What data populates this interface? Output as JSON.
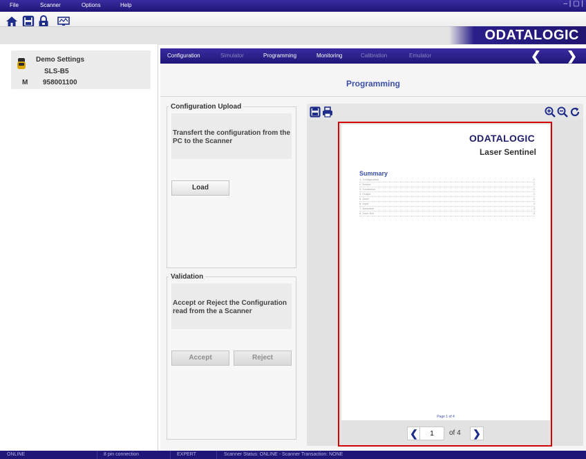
{
  "menu": {
    "file": "File",
    "scanner": "Scanner",
    "options": "Options",
    "help": "Help"
  },
  "window_controls": "– | ▢ |",
  "brand": {
    "logo": "ODATALOGIC"
  },
  "device": {
    "name": "Demo Settings",
    "model": "SLS-B5",
    "mode_letter": "M",
    "serial": "958001100"
  },
  "nav": {
    "tabs": [
      {
        "label": "Configuration",
        "active": true
      },
      {
        "label": "Simulator",
        "active": false
      },
      {
        "label": "Programming",
        "active": true
      },
      {
        "label": "Monitoring",
        "active": true
      },
      {
        "label": "Calibration",
        "active": false
      },
      {
        "label": "Emulator",
        "active": false
      }
    ],
    "prev": "❮",
    "next": "❯"
  },
  "page_title": "Programming",
  "upload": {
    "legend": "Configuration Upload",
    "description": "Transfert the configuration from the PC to the Scanner",
    "load_label": "Load"
  },
  "validation": {
    "legend": "Validation",
    "description": "Accept or Reject the Configuration read from the a Scanner",
    "accept_label": "Accept",
    "reject_label": "Reject"
  },
  "preview": {
    "doc_logo": "ODATALOGIC",
    "doc_title": "Laser Sentinel",
    "summary_heading": "Summary",
    "toc": [
      {
        "label": "1. Configuration",
        "page": "2"
      },
      {
        "label": "2. Device",
        "page": "2"
      },
      {
        "label": "3. Connector",
        "page": "2"
      },
      {
        "label": "4. Output",
        "page": "2"
      },
      {
        "label": "5. Zone",
        "page": "2"
      },
      {
        "label": "6. Input",
        "page": "3"
      },
      {
        "label": "7. Detection",
        "page": "3"
      },
      {
        "label": "8. Zone Set",
        "page": "3"
      }
    ],
    "page_footer": "Page 1 of 4"
  },
  "pager": {
    "current": "1",
    "of_label": "of 4",
    "prev": "❮",
    "next": "❯"
  },
  "status": {
    "online": "ONLINE",
    "connection": "8 pin connection",
    "level": "EXPERT",
    "scanner_status": "Scanner Status: ONLINE - Scanner Transaction: NONE"
  },
  "colors": {
    "brand_blue": "#1f1677",
    "title_blue": "#3b4fa8",
    "highlight_red": "#d40000"
  }
}
